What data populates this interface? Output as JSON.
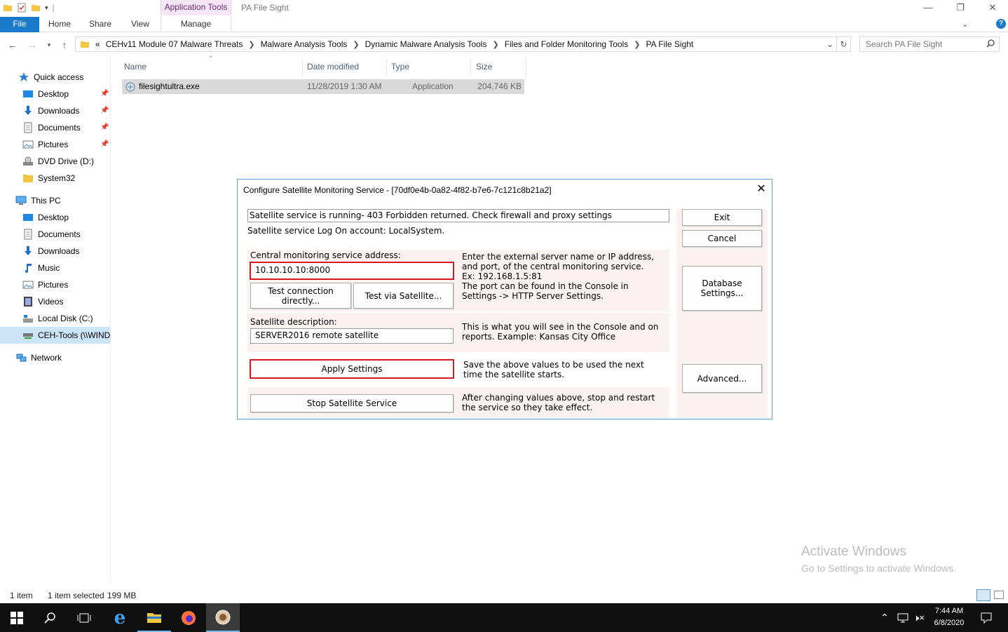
{
  "window": {
    "title": "PA File Sight",
    "app_tools_label": "Application Tools"
  },
  "ribbon": {
    "tabs": [
      "File",
      "Home",
      "Share",
      "View",
      "Manage"
    ]
  },
  "address": {
    "overflow": "«",
    "crumbs": [
      "CEHv11 Module 07 Malware Threats",
      "Malware Analysis Tools",
      "Dynamic Malware Analysis Tools",
      "Files and Folder Monitoring Tools",
      "PA File Sight"
    ],
    "search_placeholder": "Search PA File Sight"
  },
  "nav": {
    "quick_access": "Quick access",
    "quick_items": [
      "Desktop",
      "Downloads",
      "Documents",
      "Pictures",
      "DVD Drive (D:)",
      "System32"
    ],
    "this_pc": "This PC",
    "pc_items": [
      "Desktop",
      "Documents",
      "Downloads",
      "Music",
      "Pictures",
      "Videos",
      "Local Disk (C:)",
      "CEH-Tools (\\\\WIND"
    ],
    "network": "Network"
  },
  "files": {
    "columns": [
      "Name",
      "Date modified",
      "Type",
      "Size"
    ],
    "rows": [
      {
        "name": "filesightultra.exe",
        "date": "11/28/2019 1:30 AM",
        "type": "Application",
        "size": "204,746 KB"
      }
    ]
  },
  "status": {
    "count": "1 item",
    "selected": "1 item selected",
    "size": "199 MB"
  },
  "watermark": {
    "line1": "Activate Windows",
    "line2": "Go to Settings to activate Windows."
  },
  "clock": {
    "time": "7:44 AM",
    "date": "6/8/2020"
  },
  "dialog": {
    "title": "Configure Satellite Monitoring Service - [70df0e4b-0a82-4f82-b7e6-7c121c8b21a2]",
    "status_line": "Satellite service is running- 403 Forbidden returned.  Check firewall and proxy settings",
    "logon_line": "Satellite service Log On account: LocalSystem.",
    "address_label": "Central monitoring service address:",
    "address_value": "10.10.10.10:8000",
    "address_help": [
      "Enter the external server name or IP address,",
      "and port, of the central monitoring service.",
      "Ex: 192.168.1.5:81",
      "The port can be found in the Console in",
      "Settings -> HTTP Server Settings."
    ],
    "test_direct": "Test connection directly...",
    "test_satellite": "Test via Satellite...",
    "desc_label": "Satellite description:",
    "desc_value": "SERVER2016 remote satellite",
    "desc_help": [
      "This is what you will see in the Console and on",
      "reports.  Example: Kansas City Office"
    ],
    "apply": "Apply Settings",
    "apply_help": [
      "Save the above values to be used the next",
      "time the satellite starts."
    ],
    "stop": "Stop Satellite Service",
    "stop_help": [
      "After changing values above, stop and restart",
      "the service so they take effect."
    ],
    "exit": "Exit",
    "cancel": "Cancel",
    "database": "Database Settings...",
    "advanced": "Advanced..."
  }
}
